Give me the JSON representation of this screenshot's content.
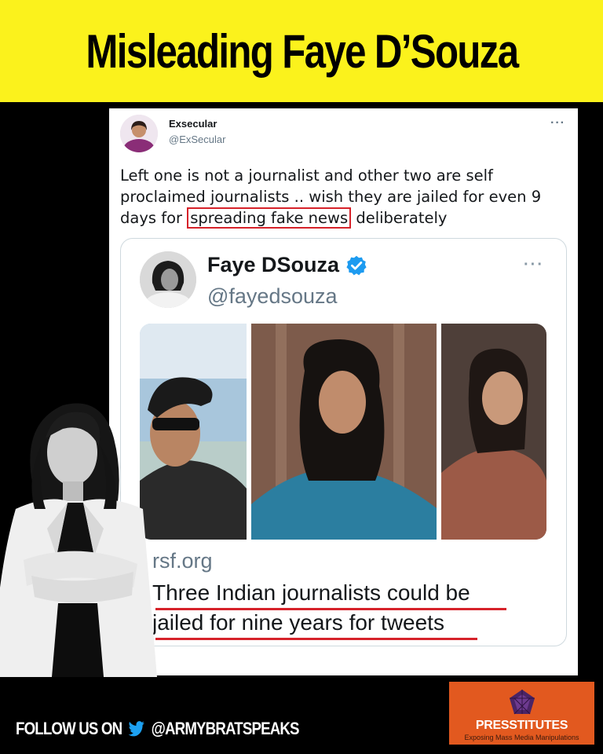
{
  "banner": {
    "title": "Misleading Faye D’Souza"
  },
  "tweet": {
    "author_name": "Exsecular",
    "author_handle": "@ExSecular",
    "more": "···",
    "text_before": "Left one is not a journalist and other two are self proclaimed journalists .. wish they are jailed for even 9 days for ",
    "text_highlight": "spreading fake news",
    "text_after": " deliberately",
    "highlight_color": "#d6222a"
  },
  "quoted": {
    "author_name": "Faye DSouza",
    "author_handle": "@fayedsouza",
    "more": "···",
    "domain": "rsf.org",
    "headline_line1": "Three Indian journalists could be",
    "headline_line2": "jailed for nine years for tweets",
    "verified_color": "#1d9bf0"
  },
  "footer": {
    "follow_label": "FOLLOW US ON",
    "handle": "@ARMYBRATSPEAKS",
    "logo_title": "PRESSTITUTES",
    "logo_subtitle": "Exposing Mass Media Manipulations",
    "logo_bg": "#e2591f"
  },
  "colors": {
    "banner_bg": "#fbf21c",
    "page_bg": "#000000",
    "twitter_blue": "#1da1f2"
  },
  "icons": {
    "verified": "verified-badge-icon",
    "twitter": "twitter-bird-icon",
    "logo": "pentagon-logo-icon"
  }
}
